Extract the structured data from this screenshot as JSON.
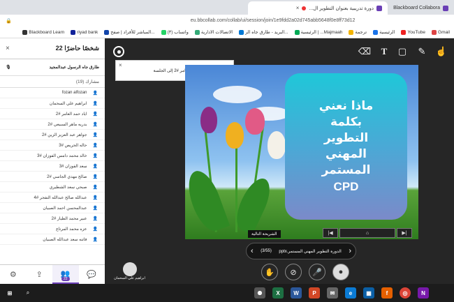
{
  "browser": {
    "tabs": [
      {
        "label": "Blackboard Collabora",
        "active": false
      },
      {
        "label": "دورة تدريبية بعنوان التطوير ال...",
        "active": true
      }
    ],
    "url": "eu.bbcollab.com/collab/ui/session/join/1e9fdd2a02d745abb5648f0e8ff73d12",
    "bookmarks": [
      "Gmail",
      "YouTube",
      "الرئيسية",
      "ترجمة",
      "الرئيسية | ...Majmaah",
      "البريد - طارق جاه الر...",
      "الاتصالات الادارية",
      "(٣) واتساب",
      "المباشر للأفراد | صفح...",
      "riyad bank",
      "Blackboard Learn"
    ]
  },
  "sidebar": {
    "title": "22 شخصًا حاضرًا",
    "moderator": "طارق جاه الرسول عبدالمجيد",
    "participants_header": "مشارك (19)",
    "participants": [
      "fozan alfozan",
      "ابراهيم علي السحمان",
      "اياد حمد العامر #2",
      "بدريه ماهر السبيعي #2",
      "جواهر عبد العزيز الزين #2",
      "حاله الحريص #3",
      "خالد محمد دامس الفوزان #3",
      "سعد الفوزان #3",
      "صالح مهدي الجاسي #2",
      "صبحي سعد الشطيري",
      "عبدالله صالح عبدالله النفجر #4",
      "عبدالمحسن احمد الصبيان",
      "عبير محمد الطيار #2",
      "عزه محمد المرتاع",
      "فاتنه سعد عبدالله الصبيان"
    ],
    "attendees_badge": "22"
  },
  "toast": {
    "text": "انضم اياد حمد العامر #2 إلى الجلسة"
  },
  "slide": {
    "lines": [
      "ماذا نعني",
      "بكلمة",
      "التطوير",
      "المهني",
      "المستمر",
      "CPD"
    ]
  },
  "tooltip": "الشريحة التالية",
  "file_nav": {
    "name": "الدورة التطوير المهني المستمر.pptx",
    "page": "(3/55)"
  },
  "self": {
    "name": "ابراهيم علي السحمان"
  },
  "icons": {
    "tools": [
      "eraser-icon",
      "text-icon",
      "shape-icon",
      "pen-icon",
      "pointer-icon"
    ]
  }
}
